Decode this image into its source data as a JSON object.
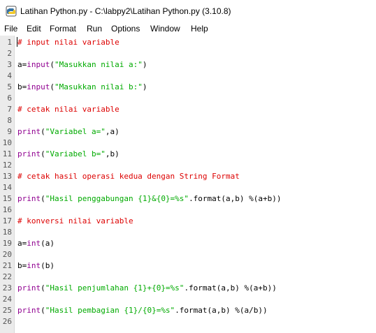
{
  "window": {
    "title": "Latihan Python.py - C:\\labpy2\\Latihan Python.py (3.10.8)"
  },
  "menu": [
    "File",
    "Edit",
    "Format",
    "Run",
    "Options",
    "Window",
    "Help"
  ],
  "colors": {
    "comment": "#dd0000",
    "builtin": "#900090",
    "string": "#00aa00",
    "plain": "#000000",
    "gutter": "#ebebeb"
  },
  "editor": {
    "lines": [
      {
        "n": "1",
        "tokens": [
          {
            "t": "comment",
            "v": "# input nilai variable"
          }
        ]
      },
      {
        "n": "2",
        "tokens": []
      },
      {
        "n": "3",
        "tokens": [
          {
            "t": "plain",
            "v": "a="
          },
          {
            "t": "builtin",
            "v": "input"
          },
          {
            "t": "plain",
            "v": "("
          },
          {
            "t": "string",
            "v": "\"Masukkan nilai a:\""
          },
          {
            "t": "plain",
            "v": ")"
          }
        ]
      },
      {
        "n": "4",
        "tokens": []
      },
      {
        "n": "5",
        "tokens": [
          {
            "t": "plain",
            "v": "b="
          },
          {
            "t": "builtin",
            "v": "input"
          },
          {
            "t": "plain",
            "v": "("
          },
          {
            "t": "string",
            "v": "\"Masukkan nilai b:\""
          },
          {
            "t": "plain",
            "v": ")"
          }
        ]
      },
      {
        "n": "6",
        "tokens": []
      },
      {
        "n": "7",
        "tokens": [
          {
            "t": "comment",
            "v": "# cetak nilai variable"
          }
        ]
      },
      {
        "n": "8",
        "tokens": []
      },
      {
        "n": "9",
        "tokens": [
          {
            "t": "builtin",
            "v": "print"
          },
          {
            "t": "plain",
            "v": "("
          },
          {
            "t": "string",
            "v": "\"Variabel a=\""
          },
          {
            "t": "plain",
            "v": ",a)"
          }
        ]
      },
      {
        "n": "10",
        "tokens": []
      },
      {
        "n": "11",
        "tokens": [
          {
            "t": "builtin",
            "v": "print"
          },
          {
            "t": "plain",
            "v": "("
          },
          {
            "t": "string",
            "v": "\"Variabel b=\""
          },
          {
            "t": "plain",
            "v": ",b)"
          }
        ]
      },
      {
        "n": "12",
        "tokens": []
      },
      {
        "n": "13",
        "tokens": [
          {
            "t": "comment",
            "v": "# cetak hasil operasi kedua dengan String Format"
          }
        ]
      },
      {
        "n": "14",
        "tokens": []
      },
      {
        "n": "15",
        "tokens": [
          {
            "t": "builtin",
            "v": "print"
          },
          {
            "t": "plain",
            "v": "("
          },
          {
            "t": "string",
            "v": "\"Hasil penggabungan {1}&{0}=%s\""
          },
          {
            "t": "plain",
            "v": ".format(a,b) %(a+b))"
          }
        ]
      },
      {
        "n": "16",
        "tokens": []
      },
      {
        "n": "17",
        "tokens": [
          {
            "t": "comment",
            "v": "# konversi nilai variable"
          }
        ]
      },
      {
        "n": "18",
        "tokens": []
      },
      {
        "n": "19",
        "tokens": [
          {
            "t": "plain",
            "v": "a="
          },
          {
            "t": "builtin",
            "v": "int"
          },
          {
            "t": "plain",
            "v": "(a)"
          }
        ]
      },
      {
        "n": "20",
        "tokens": []
      },
      {
        "n": "21",
        "tokens": [
          {
            "t": "plain",
            "v": "b="
          },
          {
            "t": "builtin",
            "v": "int"
          },
          {
            "t": "plain",
            "v": "(b)"
          }
        ]
      },
      {
        "n": "22",
        "tokens": []
      },
      {
        "n": "23",
        "tokens": [
          {
            "t": "builtin",
            "v": "print"
          },
          {
            "t": "plain",
            "v": "("
          },
          {
            "t": "string",
            "v": "\"Hasil penjumlahan {1}+{0}=%s\""
          },
          {
            "t": "plain",
            "v": ".format(a,b) %(a+b))"
          }
        ]
      },
      {
        "n": "24",
        "tokens": []
      },
      {
        "n": "25",
        "tokens": [
          {
            "t": "builtin",
            "v": "print"
          },
          {
            "t": "plain",
            "v": "("
          },
          {
            "t": "string",
            "v": "\"Hasil pembagian {1}/{0}=%s\""
          },
          {
            "t": "plain",
            "v": ".format(a,b) %(a/b))"
          }
        ]
      },
      {
        "n": "26",
        "tokens": []
      }
    ]
  }
}
